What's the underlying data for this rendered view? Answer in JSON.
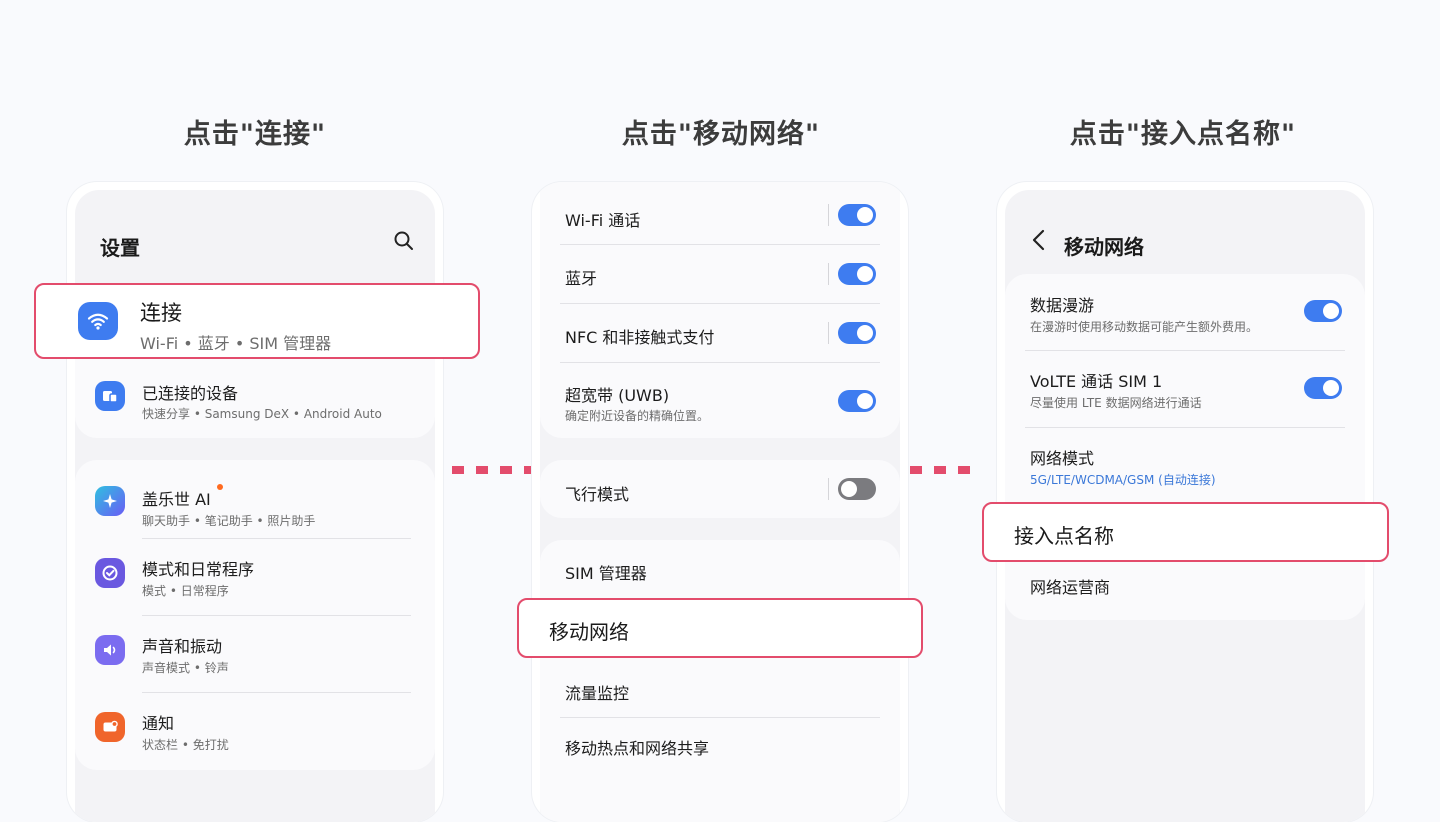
{
  "steps": [
    {
      "title": "点击\"连接\""
    },
    {
      "title": "点击\"移动网络\""
    },
    {
      "title": "点击\"接入点名称\""
    }
  ],
  "colors": {
    "highlight": "#e34c6c",
    "toggle_on": "#3e7cf0",
    "accent_link": "#3b78d8"
  },
  "phone1": {
    "header_title": "设置",
    "search_icon": "search-icon",
    "highlighted": {
      "title": "连接",
      "subtitle": "Wi-Fi • 蓝牙 • SIM 管理器",
      "icon": "wifi-icon"
    },
    "items": [
      {
        "title": "已连接的设备",
        "subtitle": "快速分享 • Samsung DeX • Android Auto",
        "icon": "connected-devices-icon"
      },
      {
        "title": "盖乐世 AI",
        "subtitle": "聊天助手 • 笔记助手 • 照片助手",
        "icon": "galaxy-ai-icon"
      },
      {
        "title": "模式和日常程序",
        "subtitle": "模式 • 日常程序",
        "icon": "modes-icon"
      },
      {
        "title": "声音和振动",
        "subtitle": "声音模式 • 铃声",
        "icon": "sound-icon"
      },
      {
        "title": "通知",
        "subtitle": "状态栏 • 免打扰",
        "icon": "notification-icon"
      }
    ]
  },
  "phone2": {
    "items": [
      {
        "title": "Wi-Fi 通话",
        "toggle": true
      },
      {
        "title": "蓝牙",
        "toggle": true
      },
      {
        "title": "NFC 和非接触式支付",
        "toggle": true
      },
      {
        "title": "超宽带 (UWB)",
        "subtitle": "确定附近设备的精确位置。",
        "toggle": true
      },
      {
        "title": "飞行模式",
        "toggle": false
      },
      {
        "title": "SIM 管理器"
      },
      {
        "title": "移动网络",
        "highlighted": true
      },
      {
        "title": "流量监控"
      },
      {
        "title": "移动热点和网络共享"
      }
    ]
  },
  "phone3": {
    "header_title": "移动网络",
    "back_icon": "back-arrow-icon",
    "items": [
      {
        "title": "数据漫游",
        "subtitle": "在漫游时使用移动数据可能产生额外费用。",
        "toggle": true
      },
      {
        "title": "VoLTE 通话 SIM 1",
        "subtitle": "尽量使用 LTE 数据网络进行通话",
        "toggle": true
      },
      {
        "title": "网络模式",
        "subtitle": "5G/LTE/WCDMA/GSM (自动连接)"
      },
      {
        "title": "接入点名称",
        "highlighted": true
      },
      {
        "title": "网络运营商"
      }
    ]
  }
}
